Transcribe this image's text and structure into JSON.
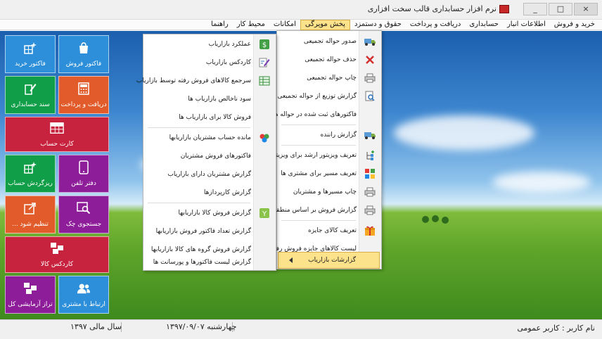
{
  "window": {
    "title": "نرم افزار حسابداری قالب سخت افزاری",
    "buttons": [
      "_",
      "□",
      "×"
    ]
  },
  "menubar": [
    {
      "label": "خرید و فروش",
      "active": false
    },
    {
      "label": "اطلاعات انبار",
      "active": false
    },
    {
      "label": "حسابداری",
      "active": false
    },
    {
      "label": "دریافت و پرداخت",
      "active": false
    },
    {
      "label": "حقوق و دستمزد",
      "active": false
    },
    {
      "label": "پخش مویرگی",
      "active": true
    },
    {
      "label": "امکانات",
      "active": false
    },
    {
      "label": "محیط کار",
      "active": false
    },
    {
      "label": "راهنما",
      "active": false
    }
  ],
  "tiles": {
    "sales_invoice": "فاکتور فروش",
    "purchase_invoice": "فاکتور خرید",
    "receive_pay": "دریافت و پرداخت",
    "accounting_doc": "سند حسابداری",
    "account_card": "کارت حساب",
    "phonebook": "دفتر تلفن",
    "account_detail": "ریزگردش حساب",
    "check_search": "جستجوی چک",
    "settings": "تنظیم شود ...",
    "goods_card": "کاردکس کالا",
    "customer_contact": "ارتباط با مشتری",
    "trial_balance": "تراز آزمایشی کل"
  },
  "distribution_menu": [
    {
      "label": "صدور حواله تجمیعی",
      "icon": "truck-icon"
    },
    {
      "label": "حذف حواله تجمیعی",
      "icon": "delete-x-icon"
    },
    {
      "label": "چاپ حواله تجمیعی",
      "icon": "printer-icon"
    },
    {
      "label": "گزارش توزیع از حواله تجمیعی",
      "icon": "magnifier-doc-icon"
    },
    {
      "label": "فاکتورهای ثبت شده در حواله ها",
      "icon": ""
    },
    {
      "label": "گزارش راننده",
      "icon": "truck-icon"
    },
    {
      "label": "تعریف ویزیتور ارشد برای ویزیتور",
      "icon": "tree-add-icon"
    },
    {
      "label": "تعریف مسیر برای مشتری ها",
      "icon": "route-grid-icon"
    },
    {
      "label": "چاپ مسیرها و مشتریان",
      "icon": "printer-icon"
    },
    {
      "label": "گزارش فروش بر اساس منطقه",
      "icon": "printer-icon"
    },
    {
      "label": "تعریف کالای جایزه",
      "icon": "gift-icon"
    },
    {
      "label": "لیست کالاهای جایزه فروش رفته",
      "icon": ""
    },
    {
      "label": "گزارشات بازاریاب",
      "icon": "arrow-left-icon"
    }
  ],
  "marketer_menu": [
    {
      "label": "عملکرد بازاریاب",
      "icon": "dollar-icon"
    },
    {
      "label": "کاردکس بازاریاب",
      "icon": "pen-doc-icon"
    },
    {
      "label": "سرجمع کالاهای فروش رفته توسط بازاریاب",
      "icon": "table-icon"
    },
    {
      "label": "سود ناخالص بازاریاب ها",
      "icon": ""
    },
    {
      "label": "فروش کالا برای بازاریاب ها",
      "icon": ""
    },
    {
      "label": "مانده حساب مشتریان بازاریابها",
      "icon": "people-icon"
    },
    {
      "label": "فاکتورهای فروش مشتریان",
      "icon": ""
    },
    {
      "label": "گزارش مشتریان دارای بازاریاب",
      "icon": ""
    },
    {
      "label": "گزارش کارپردازها",
      "icon": ""
    },
    {
      "label": "گزارش فروش کالا بازاریابها",
      "icon": "filter-y-icon"
    },
    {
      "label": "گزارش تعداد فاکتور فروش بازاریابها",
      "icon": ""
    },
    {
      "label": "گزارش فروش گروه های کالا بازاریابها",
      "icon": ""
    },
    {
      "label": "گزارش لیست فاکتورها و پورسانت ها",
      "icon": ""
    }
  ],
  "status": {
    "user": "نام کاربر : کاربر عمومی",
    "date": "چهارشنبه   ۱۳۹۷/۰۹/۰۷",
    "fiscal_year": "سال مالی ۱۳۹۷"
  },
  "colors": {
    "menu_highlight": "#fce28a",
    "tile_blue": "#2d8fd9",
    "tile_green": "#109e48",
    "tile_orange": "#e25b2a",
    "tile_red": "#c8233e",
    "tile_purple": "#8e1d9a"
  }
}
